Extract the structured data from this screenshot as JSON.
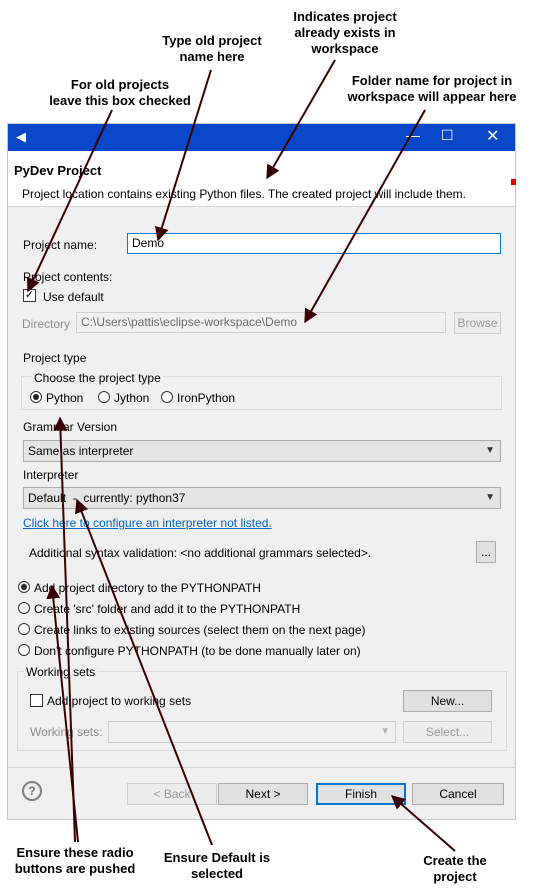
{
  "annotations": {
    "top_center": "Type old project\nname here",
    "top_right": "Indicates project\nalready exists in\nworkspace",
    "top_left": "For old projects\nleave this box checked",
    "right": "Folder name for project in\nworkspace will appear here",
    "bottom_left": "Ensure these radio\nbuttons are pushed",
    "bottom_center": "Ensure Default is\nselected",
    "bottom_right": "Create the\nproject"
  },
  "dialog": {
    "title": "PyDev Project",
    "message": "Project location contains existing Python files. The created project will include them.",
    "project_name_label": "Project name:",
    "project_name_value": "Demo",
    "project_contents_label": "Project contents:",
    "use_default_label": "Use default",
    "directory_label": "Directory",
    "directory_value": "C:\\Users\\pattis\\eclipse-workspace\\Demo",
    "browse_label": "Browse",
    "project_type_label": "Project type",
    "choose_type_label": "Choose the project type",
    "types": [
      "Python",
      "Jython",
      "IronPython"
    ],
    "grammar_label": "Grammar Version",
    "grammar_value": "Same as interpreter",
    "interpreter_label": "Interpreter",
    "interpreter_value": "Default  -  currently: python37",
    "configure_link": "Click here to configure an interpreter not listed.",
    "syntax_label": "Additional syntax validation: <no additional grammars selected>.",
    "ellipsis_button": "...",
    "pythonpath_options": [
      "Add project directory to the PYTHONPATH",
      "Create 'src' folder and add it to the PYTHONPATH",
      "Create links to existing sources (select them on the next page)",
      "Don't configure PYTHONPATH (to be done manually later on)"
    ],
    "working_sets_title": "Working sets",
    "add_to_working_sets": "Add project to working sets",
    "new_button": "New...",
    "working_sets_label": "Working sets:",
    "select_button": "Select...",
    "help_glyph": "?",
    "back_button": "< Back",
    "next_button": "Next >",
    "finish_button": "Finish",
    "cancel_button": "Cancel"
  },
  "colors": {
    "titlebar": "#0a46c8",
    "arrow": "#3a0000",
    "link": "#0066cc",
    "focus": "#0078d7"
  }
}
